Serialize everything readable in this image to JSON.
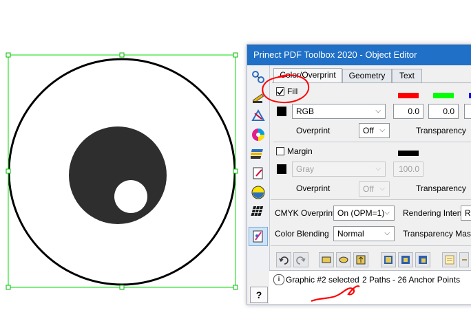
{
  "window": {
    "title": "Prinect PDF Toolbox 2020 - Object Editor"
  },
  "tabs": [
    {
      "label": "Color/Overprint",
      "active": true
    },
    {
      "label": "Geometry",
      "active": false
    },
    {
      "label": "Text",
      "active": false
    }
  ],
  "fill": {
    "label": "Fill",
    "checked": true,
    "color_space": "RGB",
    "values": [
      "0.0",
      "0.0"
    ],
    "channel_colors": [
      "#ff0000",
      "#00ff00",
      "#0000ff"
    ],
    "overprint_label": "Overprint",
    "overprint_value": "Off",
    "transparency_label": "Transparency"
  },
  "margin": {
    "label": "Margin",
    "checked": false,
    "color_space": "Gray",
    "value": "100.0",
    "overprint_label": "Overprint",
    "overprint_value": "Off",
    "transparency_label": "Transparency"
  },
  "cmyk_overprint": {
    "label": "CMYK Overprint",
    "value": "On (OPM=1)"
  },
  "rendering_intent": {
    "label": "Rendering Intent",
    "value": "R"
  },
  "color_blending": {
    "label": "Color Blending",
    "value": "Normal"
  },
  "transparency_masking": {
    "label": "Transparency Maski"
  },
  "status": {
    "selection": "Graphic #2 selected",
    "details": "2 Paths - 26 Anchor Points"
  },
  "help_label": "?",
  "colors": {
    "titlebar": "#1f70c6",
    "selection_box": "#00dd00",
    "annotation": "#ff0000",
    "shape_fill": "#2d2e2d"
  }
}
